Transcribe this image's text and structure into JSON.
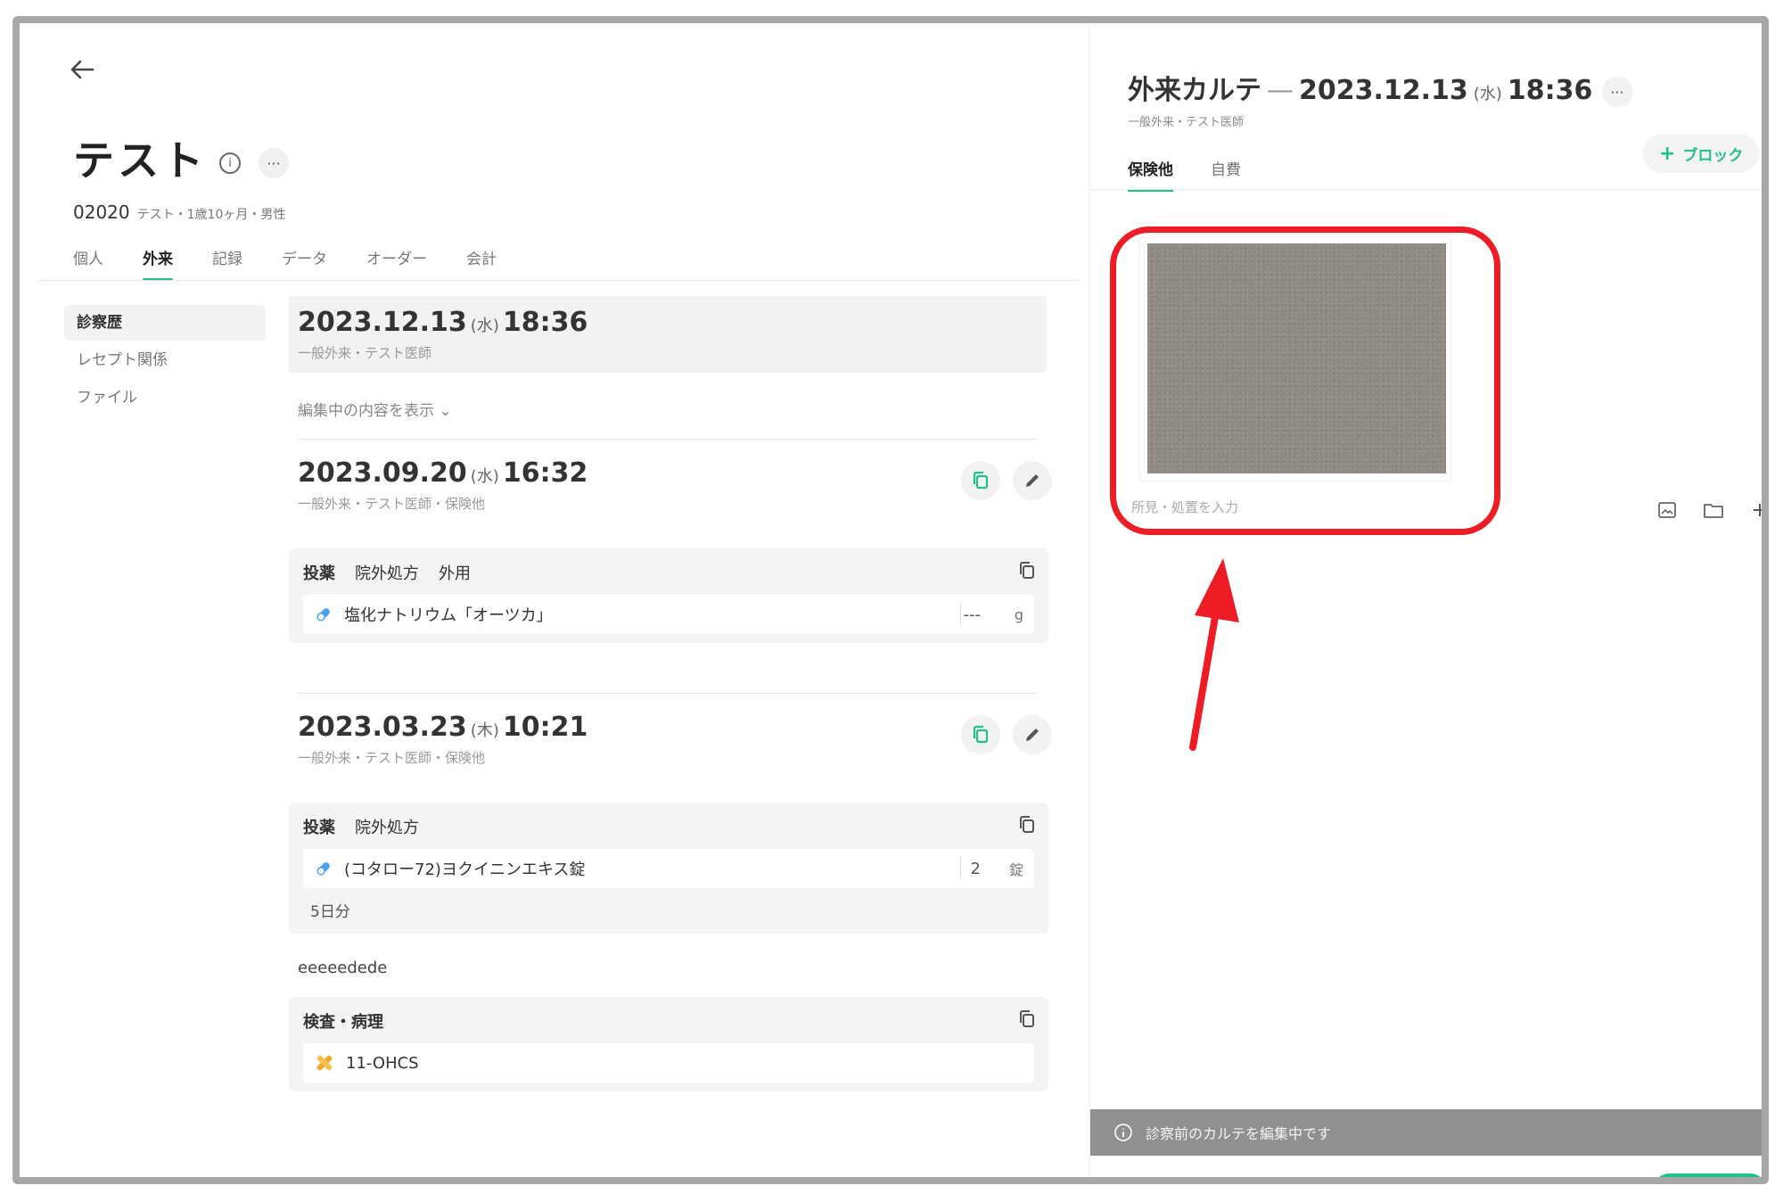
{
  "patient": {
    "name": "テスト",
    "id": "02020",
    "meta": "テスト・1歳10ヶ月・男性"
  },
  "tabs": [
    {
      "label": "個人"
    },
    {
      "label": "外来"
    },
    {
      "label": "記録"
    },
    {
      "label": "データ"
    },
    {
      "label": "オーダー"
    },
    {
      "label": "会計"
    }
  ],
  "subnav": [
    {
      "label": "診察歴"
    },
    {
      "label": "レセプト関係"
    },
    {
      "label": "ファイル"
    }
  ],
  "current_visit": {
    "date": "2023.12.13",
    "dow": "(水)",
    "time": "18:36",
    "sub": "一般外来・テスト医師",
    "show_edit": "編集中の内容を表示 ⌄"
  },
  "visits": [
    {
      "date": "2023.09.20",
      "dow": "(水)",
      "time": "16:32",
      "sub": "一般外来・テスト医師・保険他",
      "block": {
        "title1": "投薬",
        "title2": "院外処方",
        "title3": "外用",
        "drug": "塩化ナトリウム「オーツカ」",
        "qty": "---",
        "unit": "g"
      }
    },
    {
      "date": "2023.03.23",
      "dow": "(木)",
      "time": "10:21",
      "sub": "一般外来・テスト医師・保険他",
      "block": {
        "title1": "投薬",
        "title2": "院外処方",
        "drug": "(コタロー72)ヨクイニンエキス錠",
        "qty": "2",
        "unit": "錠",
        "extra": "5日分"
      },
      "note": "eeeeedede",
      "block2": {
        "title1": "検査・病理",
        "item": "11-OHCS"
      }
    }
  ],
  "karte": {
    "title": "外来カルテ",
    "dash": "—",
    "date": "2023.12.13",
    "dow": "(水)",
    "time": "18:36",
    "sub": "一般外来・テスト医師",
    "add_block": "ブロック",
    "tabs": [
      {
        "label": "保険他"
      },
      {
        "label": "自費"
      }
    ],
    "input_placeholder": "所見・処置を入力",
    "status": "診察前のカルテを編集中です"
  },
  "colors": {
    "accent": "#21c08b",
    "highlight": "#ee1c24",
    "status_bar": "#909090"
  }
}
